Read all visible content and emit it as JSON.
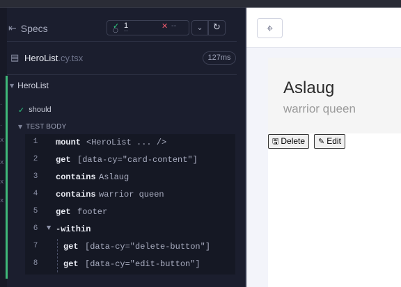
{
  "reporter": {
    "header": {
      "specs_label": "Specs",
      "specs_icon": "collapse-sidebar-icon"
    },
    "stats": {
      "passed": "1",
      "failed": "--",
      "pending": "--"
    },
    "spec_file": {
      "name": "HeroList",
      "ext": ".cy.tsx",
      "duration": "127ms"
    },
    "suite": {
      "title": "HeroList"
    },
    "test": {
      "title": "should",
      "body_label": "TEST BODY"
    },
    "commands": [
      {
        "num": "1",
        "name": "mount",
        "arg": "<HeroList ... />"
      },
      {
        "num": "2",
        "name": "get",
        "arg": "[data-cy=\"card-content\"]"
      },
      {
        "num": "3",
        "name": "contains",
        "arg": "Aslaug"
      },
      {
        "num": "4",
        "name": "contains",
        "arg": "warrior queen"
      },
      {
        "num": "5",
        "name": "get",
        "arg": "footer"
      },
      {
        "num": "6",
        "name": "-within",
        "arg": ""
      },
      {
        "num": "7",
        "name": "get",
        "arg": "[data-cy=\"delete-button\"]"
      },
      {
        "num": "8",
        "name": "get",
        "arg": "[data-cy=\"edit-button\"]"
      }
    ]
  },
  "app": {
    "hero": {
      "name": "Aslaug",
      "description": "warrior queen"
    },
    "buttons": {
      "delete_label": "Delete",
      "edit_label": "Edit"
    }
  },
  "colors": {
    "pass": "#2fd184",
    "fail": "#f25b6e",
    "reporter_bg": "#1b1e2e",
    "app_bg": "#f3f4fa"
  }
}
